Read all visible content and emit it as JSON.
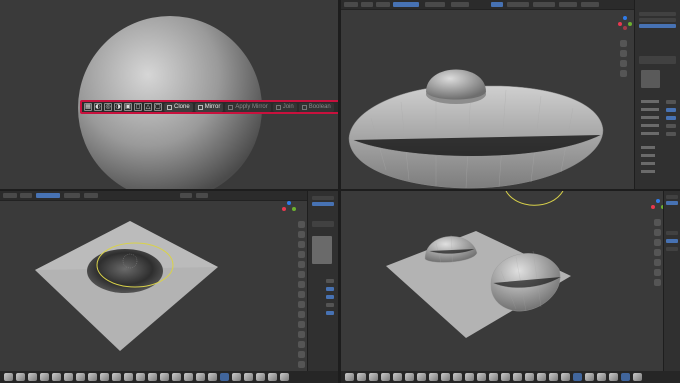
{
  "sculpt_toolbar": {
    "icons": [
      "brush-icon",
      "dyntopo-icon",
      "remesh-icon",
      "symmetry-icon",
      "mask-icon",
      "face-set-icon",
      "snap-icon",
      "mesh-icon"
    ],
    "buttons": [
      {
        "label": "Clone",
        "enabled": true
      },
      {
        "label": "Mirror",
        "enabled": true
      },
      {
        "label": "Apply Mirror",
        "enabled": false
      },
      {
        "label": "Join",
        "enabled": false
      },
      {
        "label": "Boolean",
        "enabled": false
      }
    ]
  },
  "colors": {
    "highlight": "#c8113d",
    "active": "#4772b3",
    "viewport": "#3a3a3a"
  }
}
